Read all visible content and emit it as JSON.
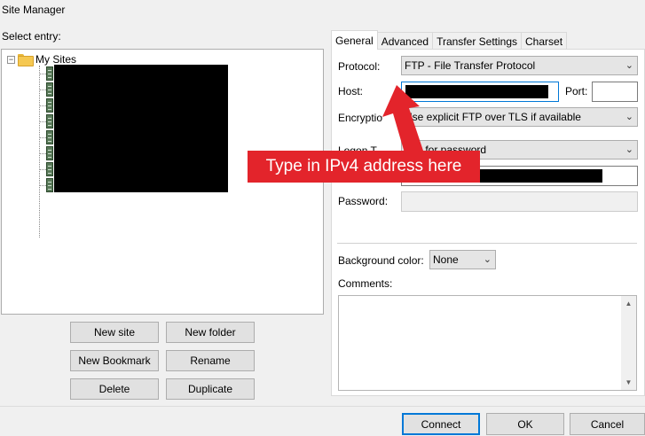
{
  "window": {
    "title": "Site Manager"
  },
  "left": {
    "select_label": "Select entry:",
    "tree": {
      "root_label": "My Sites",
      "expander": "−",
      "site_count": 8
    },
    "buttons": {
      "new_site": "New site",
      "new_folder": "New folder",
      "new_bookmark": "New Bookmark",
      "rename": "Rename",
      "delete": "Delete",
      "duplicate": "Duplicate"
    }
  },
  "tabs": [
    {
      "label": "General",
      "active": true
    },
    {
      "label": "Advanced"
    },
    {
      "label": "Transfer Settings"
    },
    {
      "label": "Charset"
    }
  ],
  "general": {
    "protocol_label": "Protocol:",
    "protocol_value": "FTP - File Transfer Protocol",
    "host_label": "Host:",
    "port_label": "Port:",
    "encryption_label": "Encryptio",
    "encryption_value": "Use explicit FTP over TLS if available",
    "logon_label": "Logon T",
    "logon_value": "Ask for password",
    "password_label": "Password:",
    "background_label": "Background color:",
    "background_value": "None",
    "comments_label": "Comments:"
  },
  "annotation": {
    "text": "Type in IPv4 address here",
    "color": "#e3242b"
  },
  "footer": {
    "connect": "Connect",
    "ok": "OK",
    "cancel": "Cancel"
  },
  "icons": {
    "folder": "folder-icon",
    "server": "server-icon",
    "dropdown": "chevron-down-icon"
  }
}
